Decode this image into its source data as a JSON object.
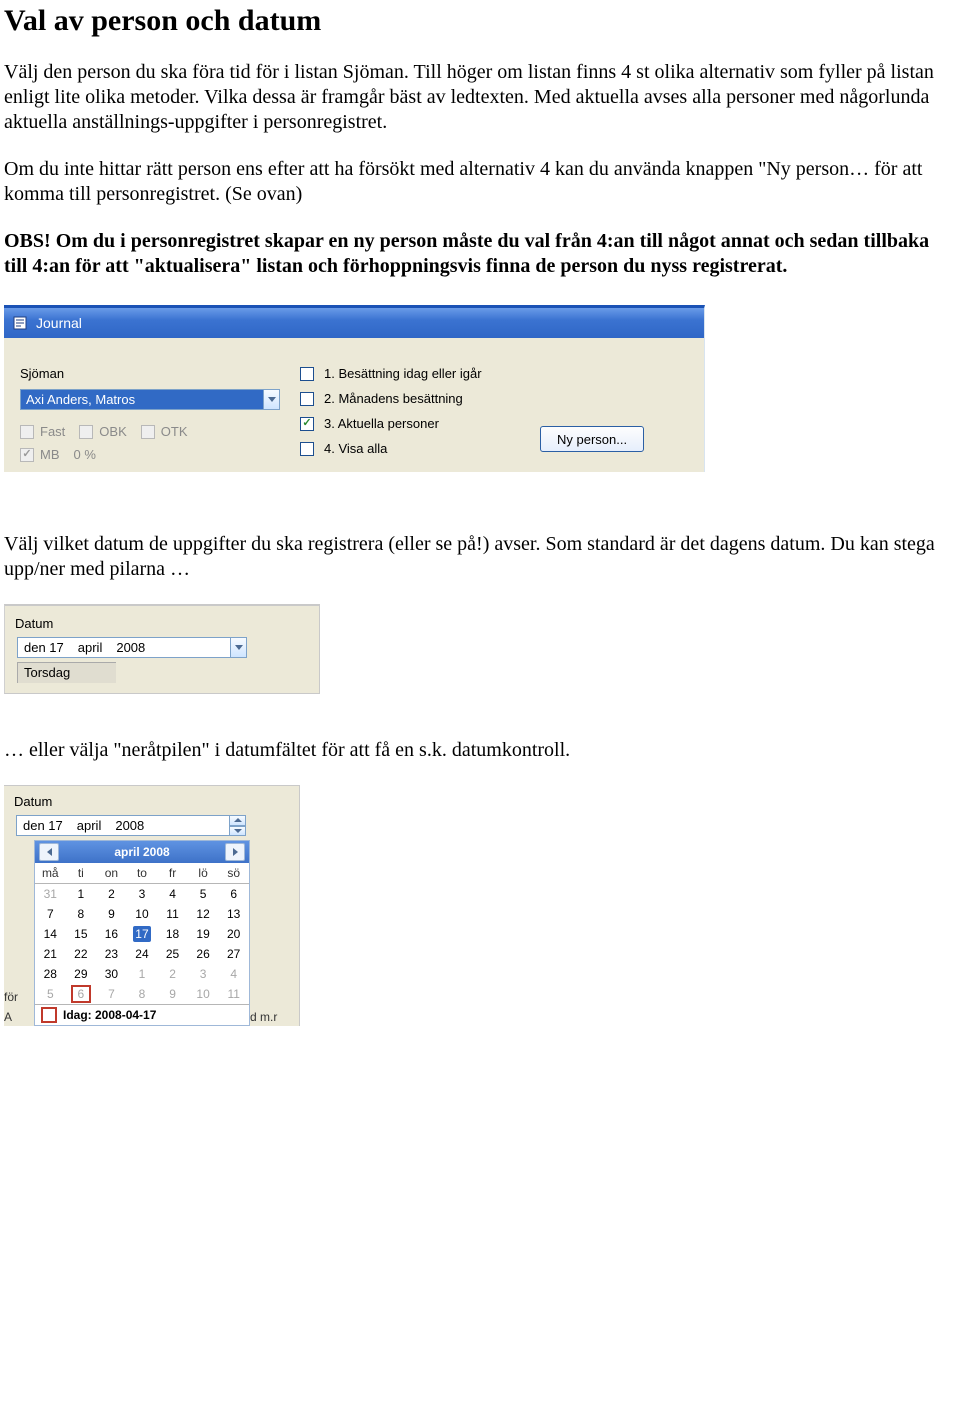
{
  "heading": "Val av person och datum",
  "p1": "Välj den person du ska föra tid för i listan Sjöman. Till höger om listan finns 4 st olika alternativ som fyller på listan enligt lite olika metoder. Vilka dessa är framgår bäst av ledtexten. Med aktuella avses alla personer med någorlunda aktuella anställnings-uppgifter i personregistret.",
  "p2": "Om du inte hittar rätt person ens efter att ha försökt med alternativ 4 kan du använda knappen \"Ny person… för att komma till personregistret. (Se ovan)",
  "obs_lead": "OBS! ",
  "obs_body": "Om du i personregistret skapar en ny person måste du val från 4:an till något annat och sedan tillbaka till 4:an för att \"aktualisera\" listan och förhoppningsvis finna de person du nyss registrerat.",
  "journal": {
    "title": "Journal",
    "label_sjoman": "Sjöman",
    "selected": "Axi Anders, Matros",
    "flags": {
      "fast": "Fast",
      "obk": "OBK",
      "otk": "OTK",
      "mb": "MB",
      "pct": "0 %"
    },
    "opts": [
      "1. Besättning idag eller igår",
      "2. Månadens besättning",
      "3. Aktuella personer",
      "4. Visa alla"
    ],
    "btn_new": "Ny person..."
  },
  "p3": "Välj vilket datum de uppgifter du ska registrera (eller se på!) avser. Som standard är det dagens datum. Du kan stega upp/ner med pilarna …",
  "date1": {
    "label": "Datum",
    "d": "den 17",
    "m": "april",
    "y": "2008",
    "weekday": "Torsdag"
  },
  "p4": "… eller välja \"neråtpilen\" i datumfältet för att få en s.k. datumkontroll.",
  "cal": {
    "label": "Datum",
    "d": "den 17",
    "m": "april",
    "y": "2008",
    "title": "april 2008",
    "dow": [
      "må",
      "ti",
      "on",
      "to",
      "fr",
      "lö",
      "sö"
    ],
    "rows": [
      [
        {
          "n": "31",
          "cls": "dim"
        },
        {
          "n": "1"
        },
        {
          "n": "2"
        },
        {
          "n": "3"
        },
        {
          "n": "4"
        },
        {
          "n": "5"
        },
        {
          "n": "6"
        }
      ],
      [
        {
          "n": "7"
        },
        {
          "n": "8"
        },
        {
          "n": "9"
        },
        {
          "n": "10"
        },
        {
          "n": "11"
        },
        {
          "n": "12"
        },
        {
          "n": "13"
        }
      ],
      [
        {
          "n": "14"
        },
        {
          "n": "15"
        },
        {
          "n": "16"
        },
        {
          "n": "17",
          "cls": "sel"
        },
        {
          "n": "18"
        },
        {
          "n": "19"
        },
        {
          "n": "20"
        }
      ],
      [
        {
          "n": "21"
        },
        {
          "n": "22"
        },
        {
          "n": "23"
        },
        {
          "n": "24"
        },
        {
          "n": "25"
        },
        {
          "n": "26"
        },
        {
          "n": "27"
        }
      ],
      [
        {
          "n": "28"
        },
        {
          "n": "29"
        },
        {
          "n": "30"
        },
        {
          "n": "1",
          "cls": "dim"
        },
        {
          "n": "2",
          "cls": "dim"
        },
        {
          "n": "3",
          "cls": "dim"
        },
        {
          "n": "4",
          "cls": "dim"
        }
      ],
      [
        {
          "n": "5",
          "cls": "dim"
        },
        {
          "n": "6",
          "cls": "dim today"
        },
        {
          "n": "7",
          "cls": "dim"
        },
        {
          "n": "8",
          "cls": "dim"
        },
        {
          "n": "9",
          "cls": "dim"
        },
        {
          "n": "10",
          "cls": "dim"
        },
        {
          "n": "11",
          "cls": "dim"
        }
      ]
    ],
    "footer": "Idag: 2008-04-17",
    "left_hint_top": "för",
    "left_hint_bot": "A",
    "right_hint": "d m.r"
  }
}
